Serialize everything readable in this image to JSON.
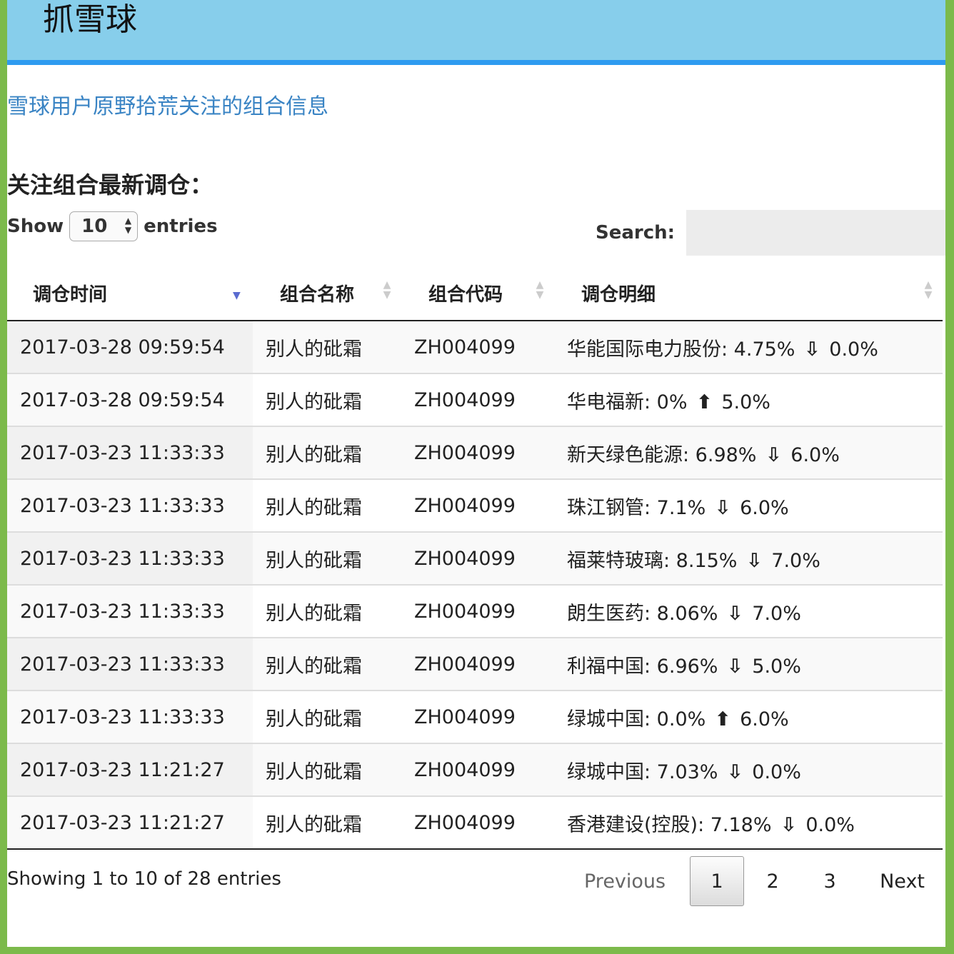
{
  "header": {
    "brand": "抓雪球"
  },
  "user_link": "雪球用户原野拾荒关注的组合信息",
  "section_title": "关注组合最新调仓：",
  "length_menu": {
    "show_label": "Show",
    "value": "10",
    "entries_label": "entries"
  },
  "search": {
    "label": "Search:",
    "value": ""
  },
  "table": {
    "columns": [
      "调仓时间",
      "组合名称",
      "组合代码",
      "调仓明细"
    ],
    "rows": [
      {
        "time": "2017-03-28 09:59:54",
        "name": "别人的砒霜",
        "code": "ZH004099",
        "stock": "华能国际电力股份: 4.75%",
        "arrow": "⇩",
        "target": "0.0%"
      },
      {
        "time": "2017-03-28 09:59:54",
        "name": "别人的砒霜",
        "code": "ZH004099",
        "stock": "华电福新: 0%",
        "arrow": "⬆",
        "target": "5.0%"
      },
      {
        "time": "2017-03-23 11:33:33",
        "name": "别人的砒霜",
        "code": "ZH004099",
        "stock": "新天绿色能源: 6.98%",
        "arrow": "⇩",
        "target": "6.0%"
      },
      {
        "time": "2017-03-23 11:33:33",
        "name": "别人的砒霜",
        "code": "ZH004099",
        "stock": "珠江钢管: 7.1%",
        "arrow": "⇩",
        "target": "6.0%"
      },
      {
        "time": "2017-03-23 11:33:33",
        "name": "别人的砒霜",
        "code": "ZH004099",
        "stock": "福莱特玻璃: 8.15%",
        "arrow": "⇩",
        "target": "7.0%"
      },
      {
        "time": "2017-03-23 11:33:33",
        "name": "别人的砒霜",
        "code": "ZH004099",
        "stock": "朗生医药: 8.06%",
        "arrow": "⇩",
        "target": "7.0%"
      },
      {
        "time": "2017-03-23 11:33:33",
        "name": "别人的砒霜",
        "code": "ZH004099",
        "stock": "利福中国: 6.96%",
        "arrow": "⇩",
        "target": "5.0%"
      },
      {
        "time": "2017-03-23 11:33:33",
        "name": "别人的砒霜",
        "code": "ZH004099",
        "stock": "绿城中国: 0.0%",
        "arrow": "⬆",
        "target": "6.0%"
      },
      {
        "time": "2017-03-23 11:21:27",
        "name": "别人的砒霜",
        "code": "ZH004099",
        "stock": "绿城中国: 7.03%",
        "arrow": "⇩",
        "target": "0.0%"
      },
      {
        "time": "2017-03-23 11:21:27",
        "name": "别人的砒霜",
        "code": "ZH004099",
        "stock": "香港建设(控股): 7.18%",
        "arrow": "⇩",
        "target": "0.0%"
      }
    ]
  },
  "info": "Showing 1 to 10 of 28 entries",
  "pagination": {
    "previous": "Previous",
    "pages": [
      "1",
      "2",
      "3"
    ],
    "current": "1",
    "next": "Next"
  },
  "colors": {
    "header_bg": "#87ceeb",
    "header_border": "#2e9bf0",
    "link": "#3a84c4",
    "frame": "#7cba4b",
    "sort_active": "#5a6bd0"
  }
}
